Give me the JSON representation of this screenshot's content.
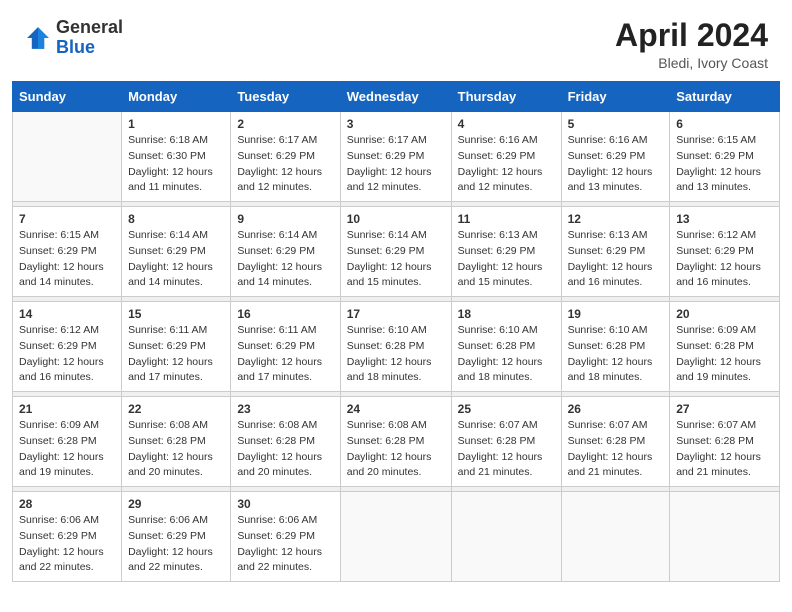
{
  "header": {
    "logo_general": "General",
    "logo_blue": "Blue",
    "month_year": "April 2024",
    "location": "Bledi, Ivory Coast"
  },
  "days_of_week": [
    "Sunday",
    "Monday",
    "Tuesday",
    "Wednesday",
    "Thursday",
    "Friday",
    "Saturday"
  ],
  "weeks": [
    [
      {
        "day": "",
        "sunrise": "",
        "sunset": "",
        "daylight": ""
      },
      {
        "day": "1",
        "sunrise": "Sunrise: 6:18 AM",
        "sunset": "Sunset: 6:30 PM",
        "daylight": "Daylight: 12 hours and 11 minutes."
      },
      {
        "day": "2",
        "sunrise": "Sunrise: 6:17 AM",
        "sunset": "Sunset: 6:29 PM",
        "daylight": "Daylight: 12 hours and 12 minutes."
      },
      {
        "day": "3",
        "sunrise": "Sunrise: 6:17 AM",
        "sunset": "Sunset: 6:29 PM",
        "daylight": "Daylight: 12 hours and 12 minutes."
      },
      {
        "day": "4",
        "sunrise": "Sunrise: 6:16 AM",
        "sunset": "Sunset: 6:29 PM",
        "daylight": "Daylight: 12 hours and 12 minutes."
      },
      {
        "day": "5",
        "sunrise": "Sunrise: 6:16 AM",
        "sunset": "Sunset: 6:29 PM",
        "daylight": "Daylight: 12 hours and 13 minutes."
      },
      {
        "day": "6",
        "sunrise": "Sunrise: 6:15 AM",
        "sunset": "Sunset: 6:29 PM",
        "daylight": "Daylight: 12 hours and 13 minutes."
      }
    ],
    [
      {
        "day": "7",
        "sunrise": "Sunrise: 6:15 AM",
        "sunset": "Sunset: 6:29 PM",
        "daylight": "Daylight: 12 hours and 14 minutes."
      },
      {
        "day": "8",
        "sunrise": "Sunrise: 6:14 AM",
        "sunset": "Sunset: 6:29 PM",
        "daylight": "Daylight: 12 hours and 14 minutes."
      },
      {
        "day": "9",
        "sunrise": "Sunrise: 6:14 AM",
        "sunset": "Sunset: 6:29 PM",
        "daylight": "Daylight: 12 hours and 14 minutes."
      },
      {
        "day": "10",
        "sunrise": "Sunrise: 6:14 AM",
        "sunset": "Sunset: 6:29 PM",
        "daylight": "Daylight: 12 hours and 15 minutes."
      },
      {
        "day": "11",
        "sunrise": "Sunrise: 6:13 AM",
        "sunset": "Sunset: 6:29 PM",
        "daylight": "Daylight: 12 hours and 15 minutes."
      },
      {
        "day": "12",
        "sunrise": "Sunrise: 6:13 AM",
        "sunset": "Sunset: 6:29 PM",
        "daylight": "Daylight: 12 hours and 16 minutes."
      },
      {
        "day": "13",
        "sunrise": "Sunrise: 6:12 AM",
        "sunset": "Sunset: 6:29 PM",
        "daylight": "Daylight: 12 hours and 16 minutes."
      }
    ],
    [
      {
        "day": "14",
        "sunrise": "Sunrise: 6:12 AM",
        "sunset": "Sunset: 6:29 PM",
        "daylight": "Daylight: 12 hours and 16 minutes."
      },
      {
        "day": "15",
        "sunrise": "Sunrise: 6:11 AM",
        "sunset": "Sunset: 6:29 PM",
        "daylight": "Daylight: 12 hours and 17 minutes."
      },
      {
        "day": "16",
        "sunrise": "Sunrise: 6:11 AM",
        "sunset": "Sunset: 6:29 PM",
        "daylight": "Daylight: 12 hours and 17 minutes."
      },
      {
        "day": "17",
        "sunrise": "Sunrise: 6:10 AM",
        "sunset": "Sunset: 6:28 PM",
        "daylight": "Daylight: 12 hours and 18 minutes."
      },
      {
        "day": "18",
        "sunrise": "Sunrise: 6:10 AM",
        "sunset": "Sunset: 6:28 PM",
        "daylight": "Daylight: 12 hours and 18 minutes."
      },
      {
        "day": "19",
        "sunrise": "Sunrise: 6:10 AM",
        "sunset": "Sunset: 6:28 PM",
        "daylight": "Daylight: 12 hours and 18 minutes."
      },
      {
        "day": "20",
        "sunrise": "Sunrise: 6:09 AM",
        "sunset": "Sunset: 6:28 PM",
        "daylight": "Daylight: 12 hours and 19 minutes."
      }
    ],
    [
      {
        "day": "21",
        "sunrise": "Sunrise: 6:09 AM",
        "sunset": "Sunset: 6:28 PM",
        "daylight": "Daylight: 12 hours and 19 minutes."
      },
      {
        "day": "22",
        "sunrise": "Sunrise: 6:08 AM",
        "sunset": "Sunset: 6:28 PM",
        "daylight": "Daylight: 12 hours and 20 minutes."
      },
      {
        "day": "23",
        "sunrise": "Sunrise: 6:08 AM",
        "sunset": "Sunset: 6:28 PM",
        "daylight": "Daylight: 12 hours and 20 minutes."
      },
      {
        "day": "24",
        "sunrise": "Sunrise: 6:08 AM",
        "sunset": "Sunset: 6:28 PM",
        "daylight": "Daylight: 12 hours and 20 minutes."
      },
      {
        "day": "25",
        "sunrise": "Sunrise: 6:07 AM",
        "sunset": "Sunset: 6:28 PM",
        "daylight": "Daylight: 12 hours and 21 minutes."
      },
      {
        "day": "26",
        "sunrise": "Sunrise: 6:07 AM",
        "sunset": "Sunset: 6:28 PM",
        "daylight": "Daylight: 12 hours and 21 minutes."
      },
      {
        "day": "27",
        "sunrise": "Sunrise: 6:07 AM",
        "sunset": "Sunset: 6:28 PM",
        "daylight": "Daylight: 12 hours and 21 minutes."
      }
    ],
    [
      {
        "day": "28",
        "sunrise": "Sunrise: 6:06 AM",
        "sunset": "Sunset: 6:29 PM",
        "daylight": "Daylight: 12 hours and 22 minutes."
      },
      {
        "day": "29",
        "sunrise": "Sunrise: 6:06 AM",
        "sunset": "Sunset: 6:29 PM",
        "daylight": "Daylight: 12 hours and 22 minutes."
      },
      {
        "day": "30",
        "sunrise": "Sunrise: 6:06 AM",
        "sunset": "Sunset: 6:29 PM",
        "daylight": "Daylight: 12 hours and 22 minutes."
      },
      {
        "day": "",
        "sunrise": "",
        "sunset": "",
        "daylight": ""
      },
      {
        "day": "",
        "sunrise": "",
        "sunset": "",
        "daylight": ""
      },
      {
        "day": "",
        "sunrise": "",
        "sunset": "",
        "daylight": ""
      },
      {
        "day": "",
        "sunrise": "",
        "sunset": "",
        "daylight": ""
      }
    ]
  ]
}
